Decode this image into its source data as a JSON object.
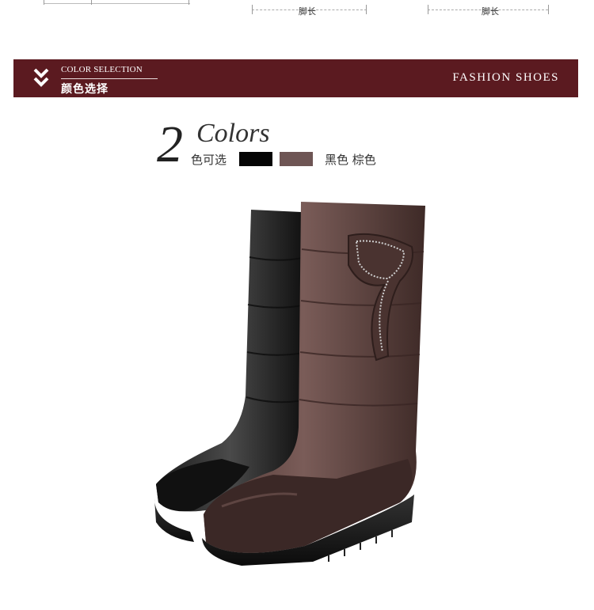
{
  "top_strip": {
    "foot_label_1": "脚长",
    "foot_label_2": "脚长"
  },
  "banner": {
    "title_en": "COLOR SELECTION",
    "title_cn": "颜色选择",
    "right_text": "FASHION SHOES",
    "background": "#5b1a20",
    "icon": "double-chevron-down-icon"
  },
  "colors": {
    "count": "2",
    "word": "Colors",
    "option_label": "色可选",
    "names": "黑色  棕色",
    "swatches": [
      {
        "name": "black",
        "hex": "#050505"
      },
      {
        "name": "brown",
        "hex": "#6e5554"
      }
    ]
  },
  "product": {
    "icon": "boots-photo"
  }
}
